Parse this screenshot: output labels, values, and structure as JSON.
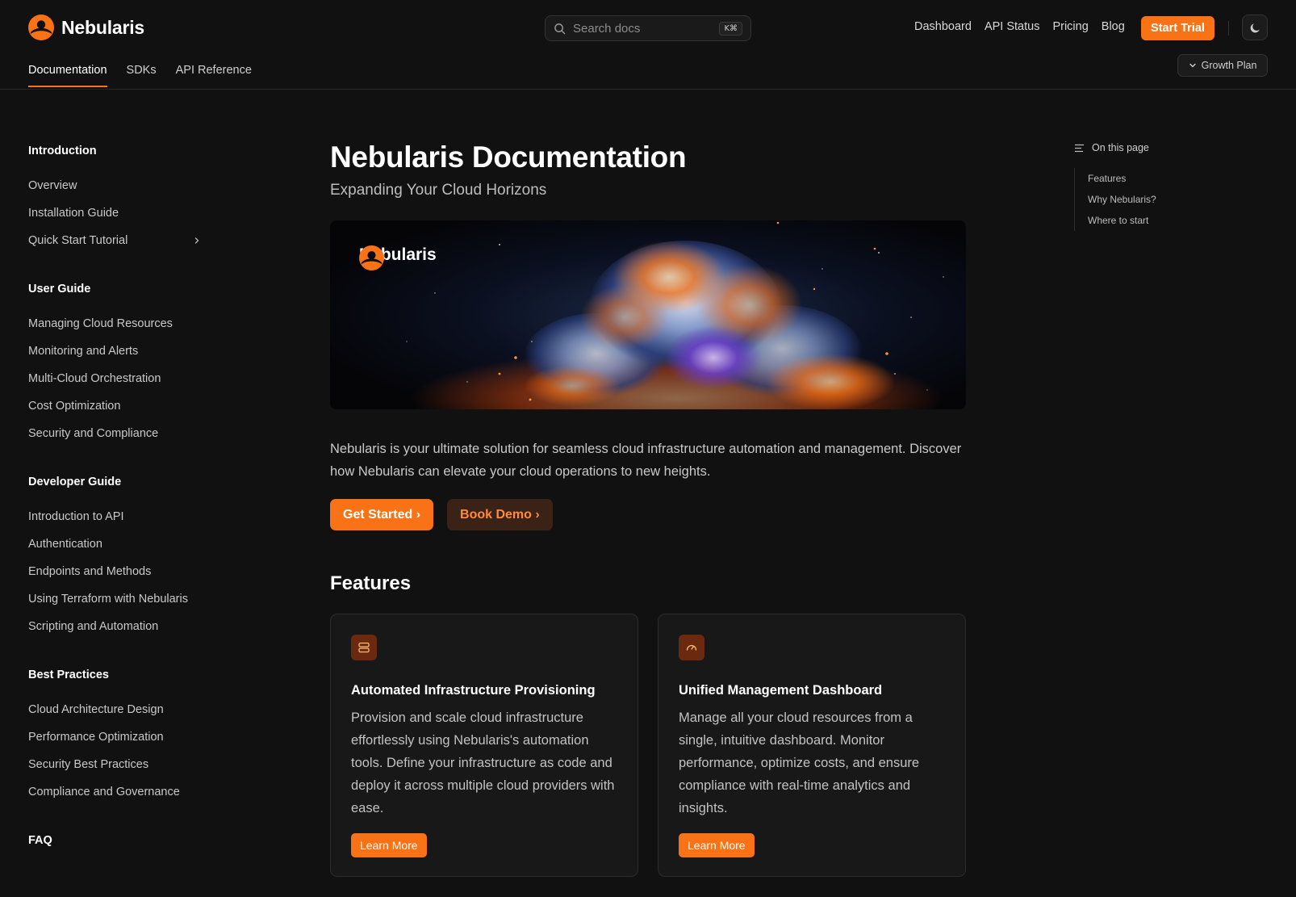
{
  "header": {
    "brand": "Nebularis",
    "search_placeholder": "Search docs",
    "search_shortcut": "K⌘",
    "nav": [
      "Dashboard",
      "API Status",
      "Pricing",
      "Blog"
    ],
    "cta": "Start Trial",
    "tabs": [
      "Documentation",
      "SDKs",
      "API Reference"
    ],
    "active_tab": "Documentation",
    "plan": "Growth Plan",
    "accent": "#f97316"
  },
  "sidebar": {
    "sections": [
      {
        "title": "Introduction",
        "items": [
          "Overview",
          "Installation Guide",
          "Quick Start Tutorial"
        ]
      },
      {
        "title": "User Guide",
        "items": [
          "Managing Cloud Resources",
          "Monitoring and Alerts",
          "Multi-Cloud Orchestration",
          "Cost Optimization",
          "Security and Compliance"
        ]
      },
      {
        "title": "Developer Guide",
        "items": [
          "Introduction to API",
          "Authentication",
          "Endpoints and Methods",
          "Using Terraform with Nebularis",
          "Scripting and Automation"
        ]
      },
      {
        "title": "Best Practices",
        "items": [
          "Cloud Architecture Design",
          "Performance Optimization",
          "Security Best Practices",
          "Compliance and Governance"
        ]
      },
      {
        "title": "FAQ",
        "items": []
      }
    ]
  },
  "main": {
    "title": "Nebularis Documentation",
    "subtitle": "Expanding Your Cloud Horizons",
    "hero_brand": "Nebularis",
    "intro": "Nebularis is your ultimate solution for seamless cloud infrastructure automation and management. Discover how Nebularis can elevate your cloud operations to new heights.",
    "get_started": "Get Started ›",
    "book_demo": "Book Demo ›",
    "features_heading": "Features",
    "cards": [
      {
        "icon": "server-stack-icon",
        "title": "Automated Infrastructure Provisioning",
        "text": "Provision and scale cloud infrastructure effortlessly using Nebularis's automation tools. Define your infrastructure as code and deploy it across multiple cloud providers with ease.",
        "button": "Learn More"
      },
      {
        "icon": "gauge-icon",
        "title": "Unified Management Dashboard",
        "text": "Manage all your cloud resources from a single, intuitive dashboard. Monitor performance, optimize costs, and ensure compliance with real-time analytics and insights.",
        "button": "Learn More"
      }
    ]
  },
  "toc": {
    "heading": "On this page",
    "items": [
      "Features",
      "Why Nebularis?",
      "Where to start"
    ]
  }
}
